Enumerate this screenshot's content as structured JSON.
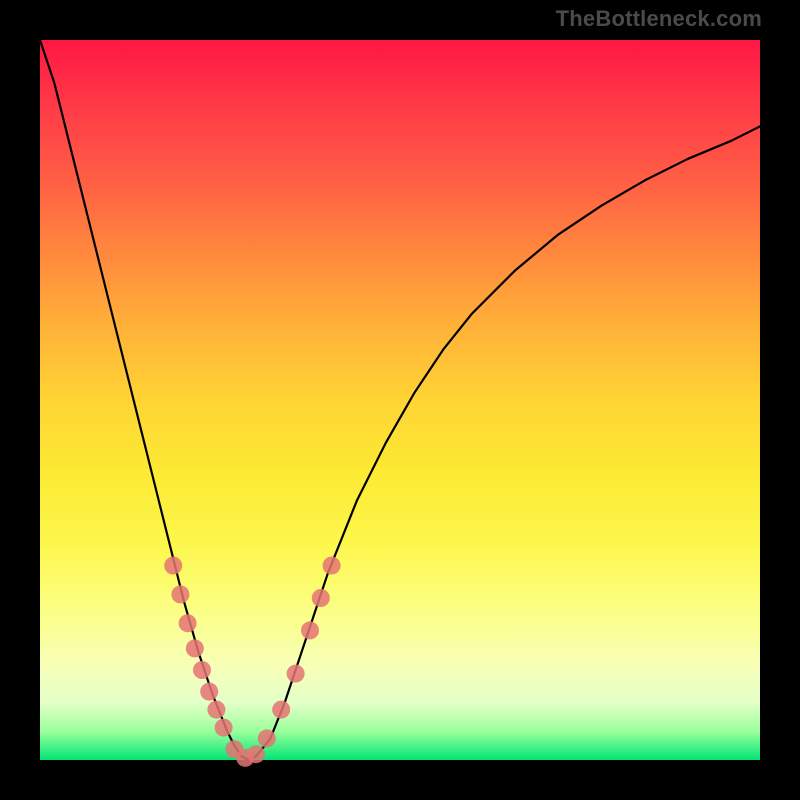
{
  "watermark": "TheBottleneck.com",
  "chart_data": {
    "type": "line",
    "title": "",
    "xlabel": "",
    "ylabel": "",
    "xlim": [
      0,
      100
    ],
    "ylim": [
      0,
      100
    ],
    "background_gradient": {
      "direction": "vertical",
      "stops": [
        {
          "pos": 0,
          "color": "#ff1744"
        },
        {
          "pos": 50,
          "color": "#ffd434"
        },
        {
          "pos": 80,
          "color": "#fbff8a"
        },
        {
          "pos": 100,
          "color": "#00e676"
        }
      ]
    },
    "series": [
      {
        "name": "bottleneck-curve",
        "color": "#000000",
        "x": [
          0,
          2,
          4,
          6,
          8,
          10,
          12,
          14,
          16,
          18,
          20,
          22,
          24,
          26,
          27,
          28,
          29,
          30,
          32,
          34,
          36,
          38,
          40,
          44,
          48,
          52,
          56,
          60,
          66,
          72,
          78,
          84,
          90,
          96,
          100
        ],
        "y": [
          100,
          94,
          86,
          78,
          70,
          62,
          54,
          46,
          38,
          30,
          22,
          15,
          9,
          4,
          2,
          0.5,
          0,
          0.5,
          3,
          8,
          14,
          20,
          26,
          36,
          44,
          51,
          57,
          62,
          68,
          73,
          77,
          80.5,
          83.5,
          86,
          88
        ]
      }
    ],
    "scatter_markers": {
      "name": "highlighted-points",
      "color": "#e57373",
      "radius": 9,
      "x": [
        18.5,
        19.5,
        20.5,
        21.5,
        22.5,
        23.5,
        24.5,
        25.5,
        27.0,
        28.5,
        30.0,
        31.5,
        33.5,
        35.5,
        37.5,
        39.0,
        40.5
      ],
      "y": [
        27.0,
        23.0,
        19.0,
        15.5,
        12.5,
        9.5,
        7.0,
        4.5,
        1.5,
        0.3,
        0.8,
        3.0,
        7.0,
        12.0,
        18.0,
        22.5,
        27.0
      ]
    }
  }
}
